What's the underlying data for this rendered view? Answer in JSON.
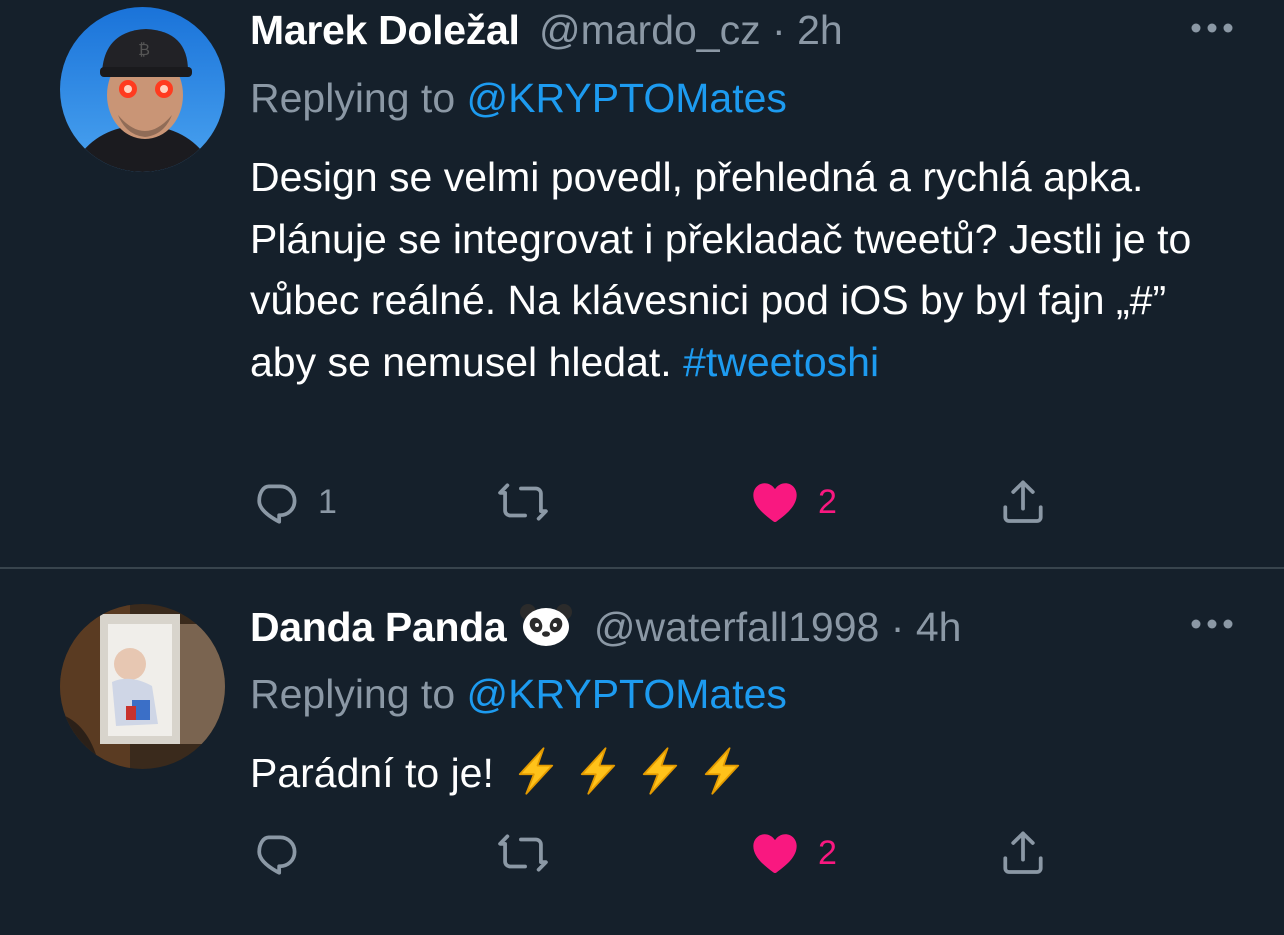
{
  "tweets": [
    {
      "display_name": "Marek Doležal",
      "handle": "@mardo_cz",
      "separator": "·",
      "time": "2h",
      "replying_to_prefix": "Replying to",
      "replying_to_handle": "@KRYPTOMates",
      "text": "Design se velmi povedl, přehledná a rychlá apka. Plánuje se integrovat i překladač tweetů? Jestli je to vůbec reálné. Na klávesnici pod iOS by byl fajn „#” aby se nemusel hledat.",
      "hashtag": "#tweetoshi",
      "reply_count": "1",
      "retweet_count": "",
      "like_count": "2",
      "liked": true,
      "avatar_icon": "avatar-photo"
    },
    {
      "display_name": "Danda Panda",
      "name_emoji": "panda-emoji",
      "handle": "@waterfall1998",
      "separator": "·",
      "time": "4h",
      "replying_to_prefix": "Replying to",
      "replying_to_handle": "@KRYPTOMates",
      "text": "Parádní to je!",
      "text_emoji": [
        "lightning-emoji",
        "lightning-emoji",
        "lightning-emoji",
        "lightning-emoji"
      ],
      "reply_count": "",
      "retweet_count": "",
      "like_count": "2",
      "liked": true,
      "avatar_icon": "avatar-photo"
    }
  ],
  "colors": {
    "background": "#15202b",
    "text_primary": "#ffffff",
    "text_secondary": "#8b98a5",
    "accent": "#1d9bf0",
    "like": "#f91880",
    "divider": "#38444d"
  },
  "icons": {
    "more": "more-horizontal-icon",
    "reply": "reply-icon",
    "retweet": "retweet-icon",
    "like": "heart-filled-icon",
    "share": "share-icon"
  }
}
